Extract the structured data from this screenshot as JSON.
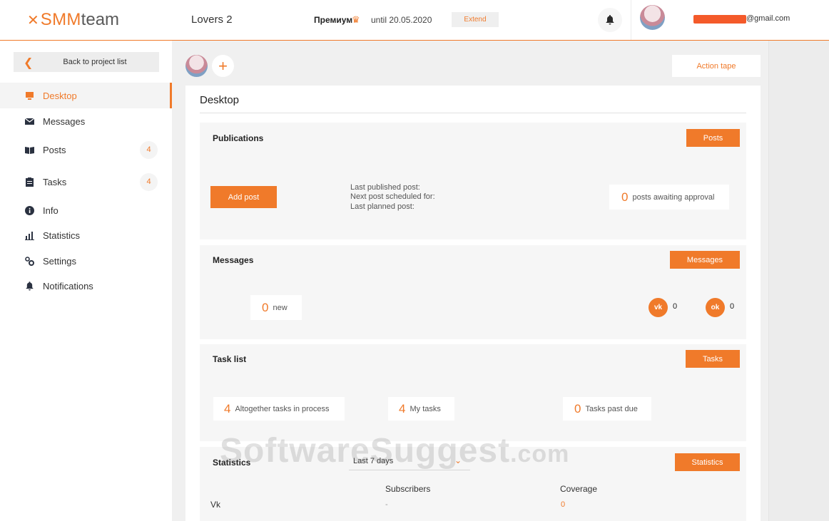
{
  "header": {
    "logo_mark": "✕",
    "logo_smm": "SMM",
    "logo_team": "team",
    "project_name": "Lovers 2",
    "plan_name": "Премиум",
    "plan_until": "until 20.05.2020",
    "extend_label": "Extend",
    "email_suffix": "@gmail.com"
  },
  "sidebar": {
    "back_label": "Back to project list",
    "items": [
      {
        "label": "Desktop",
        "icon": "monitor-icon",
        "active": true
      },
      {
        "label": "Messages",
        "icon": "envelope-icon"
      },
      {
        "label": "Posts",
        "icon": "book-icon",
        "badge": "4"
      },
      {
        "label": "Tasks",
        "icon": "clipboard-icon",
        "badge": "4"
      },
      {
        "label": "Info",
        "icon": "info-icon"
      },
      {
        "label": "Statistics",
        "icon": "bar-chart-icon"
      },
      {
        "label": "Settings",
        "icon": "gear-icon"
      },
      {
        "label": "Notifications",
        "icon": "bell-icon"
      }
    ]
  },
  "main": {
    "action_tape_label": "Action tape",
    "add_project_symbol": "+",
    "title": "Desktop",
    "publications": {
      "title": "Publications",
      "button": "Posts",
      "add_post": "Add post",
      "last_published": "Last published post:",
      "next_scheduled": "Next post scheduled for:",
      "last_planned": "Last planned post:",
      "awaiting_count": "0",
      "awaiting_label": "posts awaiting approval"
    },
    "messages": {
      "title": "Messages",
      "button": "Messages",
      "new_count": "0",
      "new_label": "new",
      "vk_label": "vk",
      "vk_count": "0",
      "ok_label": "ok",
      "ok_count": "0"
    },
    "tasks": {
      "title": "Task list",
      "button": "Tasks",
      "total_count": "4",
      "total_label": "Altogether tasks in process",
      "my_count": "4",
      "my_label": "My tasks",
      "due_count": "0",
      "due_label": "Tasks past due"
    },
    "statistics": {
      "title": "Statistics",
      "period": "Last 7 days",
      "button": "Statistics",
      "col_subscribers": "Subscribers",
      "col_coverage": "Coverage",
      "row_name": "Vk",
      "row_subscribers": "-",
      "row_coverage": "0"
    }
  },
  "watermark": {
    "main": "SoftwareSuggest",
    "suffix": ".com"
  },
  "colors": {
    "accent": "#f07a2a",
    "background": "#f0f0f0",
    "section": "#f6f6f6"
  }
}
